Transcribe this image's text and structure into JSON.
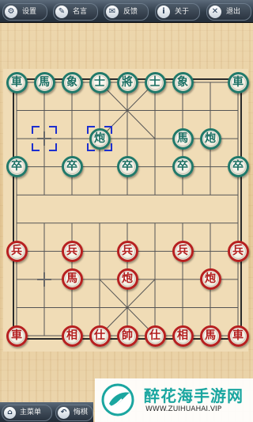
{
  "toolbar": {
    "settings": "设置",
    "quotes": "名言",
    "feedback": "反馈",
    "about": "关于",
    "exit": "退出"
  },
  "bottom_bar": {
    "main_menu": "主菜单",
    "undo": "悔棋"
  },
  "board": {
    "background_color": "#f0dcb6",
    "line_color": "#555555",
    "green_pieces": [
      {
        "char": "車",
        "pos": "a10"
      },
      {
        "char": "馬",
        "pos": "b10"
      },
      {
        "char": "象",
        "pos": "c10"
      },
      {
        "char": "士",
        "pos": "d10"
      },
      {
        "char": "將",
        "pos": "e10"
      },
      {
        "char": "士",
        "pos": "f10"
      },
      {
        "char": "象",
        "pos": "g10"
      },
      {
        "char": "車",
        "pos": "i10"
      },
      {
        "char": "炮",
        "pos": "d8"
      },
      {
        "char": "馬",
        "pos": "g8"
      },
      {
        "char": "炮",
        "pos": "h8"
      },
      {
        "char": "卒",
        "pos": "a7"
      },
      {
        "char": "卒",
        "pos": "c7"
      },
      {
        "char": "卒",
        "pos": "e7"
      },
      {
        "char": "卒",
        "pos": "g7"
      },
      {
        "char": "卒",
        "pos": "i7"
      }
    ],
    "red_pieces": [
      {
        "char": "兵",
        "pos": "a4"
      },
      {
        "char": "兵",
        "pos": "c4"
      },
      {
        "char": "兵",
        "pos": "e4"
      },
      {
        "char": "兵",
        "pos": "g4"
      },
      {
        "char": "兵",
        "pos": "i4"
      },
      {
        "char": "馬",
        "pos": "c3"
      },
      {
        "char": "炮",
        "pos": "e3"
      },
      {
        "char": "炮",
        "pos": "h3"
      },
      {
        "char": "車",
        "pos": "a1"
      },
      {
        "char": "相",
        "pos": "c1"
      },
      {
        "char": "仕",
        "pos": "d1"
      },
      {
        "char": "帥",
        "pos": "e1"
      },
      {
        "char": "仕",
        "pos": "f1"
      },
      {
        "char": "相",
        "pos": "g1"
      },
      {
        "char": "馬",
        "pos": "h1"
      },
      {
        "char": "車",
        "pos": "i1"
      }
    ],
    "selection_marks": [
      "b8",
      "d8"
    ],
    "move_hint_marks": [
      "b8",
      "b3"
    ]
  },
  "watermark": {
    "title": "醉花海手游网",
    "url": "WWW.ZUIHUAHAI.VIP"
  },
  "colors": {
    "green_piece": "#21796a",
    "red_piece": "#b72020",
    "selection": "#1d2fcf",
    "toolbar": "#2f3b48",
    "watermark_teal": "#1aa6a0"
  }
}
